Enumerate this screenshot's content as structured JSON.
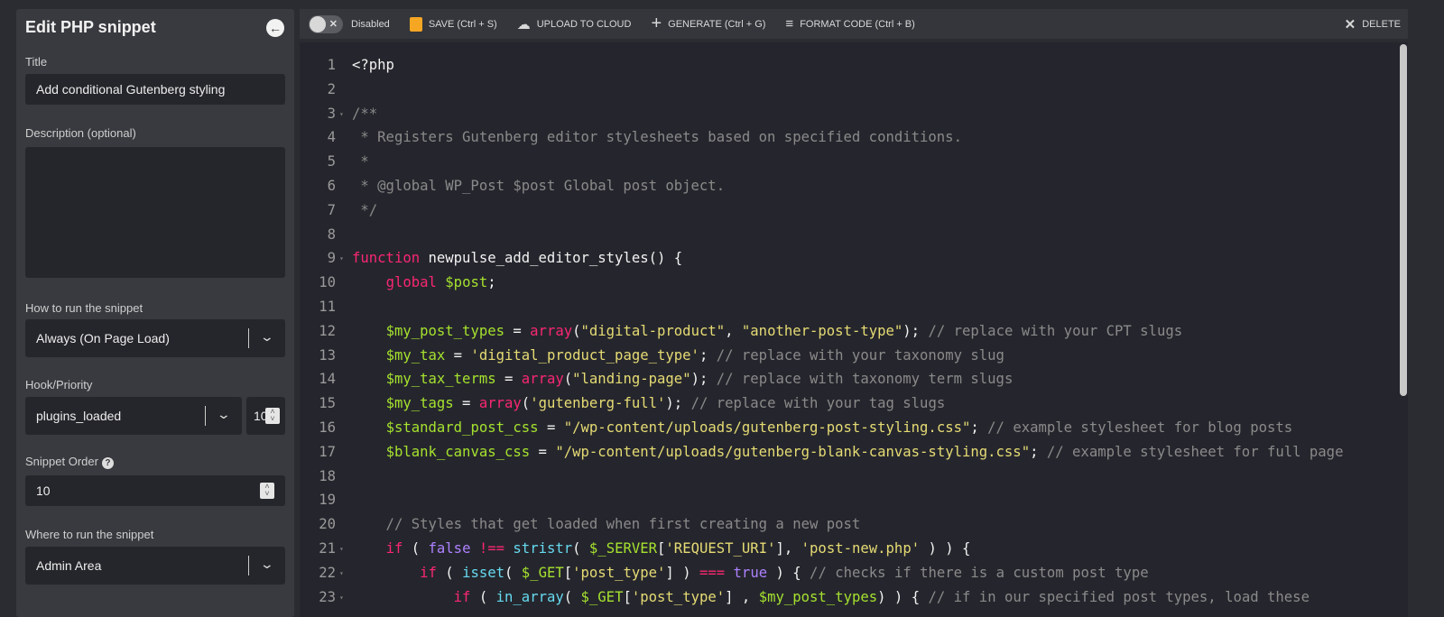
{
  "sidebar": {
    "title": "Edit PHP snippet",
    "title_label": "Title",
    "title_value": "Add conditional Gutenberg styling",
    "description_label": "Description (optional)",
    "description_value": "",
    "run_label": "How to run the snippet",
    "run_value": "Always (On Page Load)",
    "hook_label": "Hook/Priority",
    "hook_value": "plugins_loaded",
    "priority_value": "10",
    "order_label": "Snippet Order",
    "order_value": "10",
    "where_label": "Where to run the snippet",
    "where_value": "Admin Area"
  },
  "toolbar": {
    "status": "Disabled",
    "save": "SAVE (Ctrl + S)",
    "upload": "UPLOAD TO CLOUD",
    "generate": "GENERATE (Ctrl + G)",
    "format": "FORMAT CODE (Ctrl + B)",
    "delete": "DELETE",
    "save_color": "#f5a623"
  },
  "code": [
    {
      "n": "1",
      "t": [
        [
          "p",
          "<?php"
        ]
      ]
    },
    {
      "n": "2",
      "t": []
    },
    {
      "n": "3",
      "fold": true,
      "t": [
        [
          "c",
          "/**"
        ]
      ]
    },
    {
      "n": "4",
      "t": [
        [
          "c",
          " * Registers Gutenberg editor stylesheets based on specified conditions."
        ]
      ]
    },
    {
      "n": "5",
      "t": [
        [
          "c",
          " *"
        ]
      ]
    },
    {
      "n": "6",
      "t": [
        [
          "c",
          " * @global WP_Post $post Global post object."
        ]
      ]
    },
    {
      "n": "7",
      "t": [
        [
          "c",
          " */"
        ]
      ]
    },
    {
      "n": "8",
      "t": []
    },
    {
      "n": "9",
      "fold": true,
      "t": [
        [
          "k",
          "function"
        ],
        [
          "p",
          " newpulse_add_editor_styles() {"
        ]
      ]
    },
    {
      "n": "10",
      "t": [
        [
          "p",
          "    "
        ],
        [
          "k",
          "global"
        ],
        [
          "p",
          " "
        ],
        [
          "v",
          "$post"
        ],
        [
          "p",
          ";"
        ]
      ]
    },
    {
      "n": "11",
      "t": []
    },
    {
      "n": "12",
      "t": [
        [
          "p",
          "    "
        ],
        [
          "v",
          "$my_post_types"
        ],
        [
          "p",
          " = "
        ],
        [
          "k",
          "array"
        ],
        [
          "p",
          "("
        ],
        [
          "s",
          "\"digital-product\""
        ],
        [
          "p",
          ", "
        ],
        [
          "s",
          "\"another-post-type\""
        ],
        [
          "p",
          ");"
        ],
        [
          "c",
          " // replace with your CPT slugs"
        ]
      ]
    },
    {
      "n": "13",
      "t": [
        [
          "p",
          "    "
        ],
        [
          "v",
          "$my_tax"
        ],
        [
          "p",
          " = "
        ],
        [
          "s",
          "'digital_product_page_type'"
        ],
        [
          "p",
          ";"
        ],
        [
          "c",
          " // replace with your taxonomy slug"
        ]
      ]
    },
    {
      "n": "14",
      "t": [
        [
          "p",
          "    "
        ],
        [
          "v",
          "$my_tax_terms"
        ],
        [
          "p",
          " = "
        ],
        [
          "k",
          "array"
        ],
        [
          "p",
          "("
        ],
        [
          "s",
          "\"landing-page\""
        ],
        [
          "p",
          ");"
        ],
        [
          "c",
          " // replace with taxonomy term slugs"
        ]
      ]
    },
    {
      "n": "15",
      "t": [
        [
          "p",
          "    "
        ],
        [
          "v",
          "$my_tags"
        ],
        [
          "p",
          " = "
        ],
        [
          "k",
          "array"
        ],
        [
          "p",
          "("
        ],
        [
          "s",
          "'gutenberg-full'"
        ],
        [
          "p",
          ");"
        ],
        [
          "c",
          " // replace with your tag slugs"
        ]
      ]
    },
    {
      "n": "16",
      "t": [
        [
          "p",
          "    "
        ],
        [
          "v",
          "$standard_post_css"
        ],
        [
          "p",
          " = "
        ],
        [
          "s",
          "\"/wp-content/uploads/gutenberg-post-styling.css\""
        ],
        [
          "p",
          ";"
        ],
        [
          "c",
          " // example stylesheet for blog posts"
        ]
      ]
    },
    {
      "n": "17",
      "t": [
        [
          "p",
          "    "
        ],
        [
          "v",
          "$blank_canvas_css"
        ],
        [
          "p",
          " = "
        ],
        [
          "s",
          "\"/wp-content/uploads/gutenberg-blank-canvas-styling.css\""
        ],
        [
          "p",
          ";"
        ],
        [
          "c",
          " // example stylesheet for full page"
        ]
      ]
    },
    {
      "n": "18",
      "t": []
    },
    {
      "n": "19",
      "t": []
    },
    {
      "n": "20",
      "t": [
        [
          "c",
          "    // Styles that get loaded when first creating a new post"
        ]
      ]
    },
    {
      "n": "21",
      "fold": true,
      "t": [
        [
          "p",
          "    "
        ],
        [
          "k",
          "if"
        ],
        [
          "p",
          " ( "
        ],
        [
          "n",
          "false"
        ],
        [
          "p",
          " "
        ],
        [
          "k",
          "!=="
        ],
        [
          "p",
          " "
        ],
        [
          "f",
          "stristr"
        ],
        [
          "p",
          "( "
        ],
        [
          "v",
          "$_SERVER"
        ],
        [
          "p",
          "["
        ],
        [
          "s",
          "'REQUEST_URI'"
        ],
        [
          "p",
          "], "
        ],
        [
          "s",
          "'post-new.php'"
        ],
        [
          "p",
          " ) ) {"
        ]
      ]
    },
    {
      "n": "22",
      "fold": true,
      "t": [
        [
          "p",
          "        "
        ],
        [
          "k",
          "if"
        ],
        [
          "p",
          " ( "
        ],
        [
          "f",
          "isset"
        ],
        [
          "p",
          "( "
        ],
        [
          "v",
          "$_GET"
        ],
        [
          "p",
          "["
        ],
        [
          "s",
          "'post_type'"
        ],
        [
          "p",
          "] ) "
        ],
        [
          "k",
          "==="
        ],
        [
          "p",
          " "
        ],
        [
          "n",
          "true"
        ],
        [
          "p",
          " ) {"
        ],
        [
          "c",
          " // checks if there is a custom post type"
        ]
      ]
    },
    {
      "n": "23",
      "fold": true,
      "t": [
        [
          "p",
          "            "
        ],
        [
          "k",
          "if"
        ],
        [
          "p",
          " ( "
        ],
        [
          "f",
          "in_array"
        ],
        [
          "p",
          "( "
        ],
        [
          "v",
          "$_GET"
        ],
        [
          "p",
          "["
        ],
        [
          "s",
          "'post_type'"
        ],
        [
          "p",
          "] , "
        ],
        [
          "v",
          "$my_post_types"
        ],
        [
          "p",
          ") ) {"
        ],
        [
          "c",
          " // if in our specified post types, load these"
        ]
      ]
    }
  ]
}
